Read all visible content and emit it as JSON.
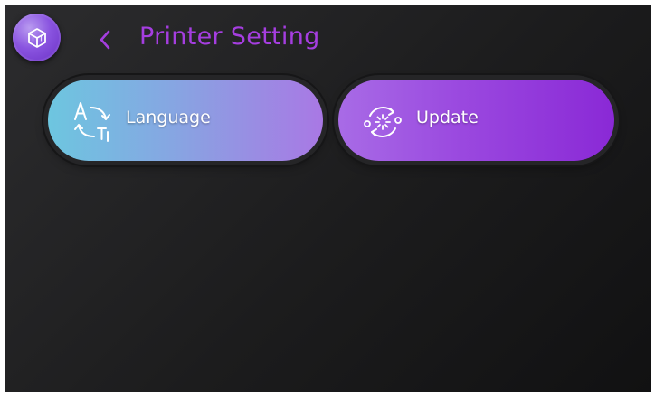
{
  "header": {
    "logo_icon": "cube-icon",
    "back_icon": "chevron-left-icon",
    "title": "Printer Setting",
    "title_color": "#a53ee0"
  },
  "menu": [
    {
      "id": "language",
      "label": "Language",
      "icon": "translate-icon",
      "gradient": [
        "#6dc6e0",
        "#a978e4"
      ]
    },
    {
      "id": "update",
      "label": "Update",
      "icon": "update-icon",
      "gradient": [
        "#a86be6",
        "#8a29d6"
      ]
    }
  ]
}
